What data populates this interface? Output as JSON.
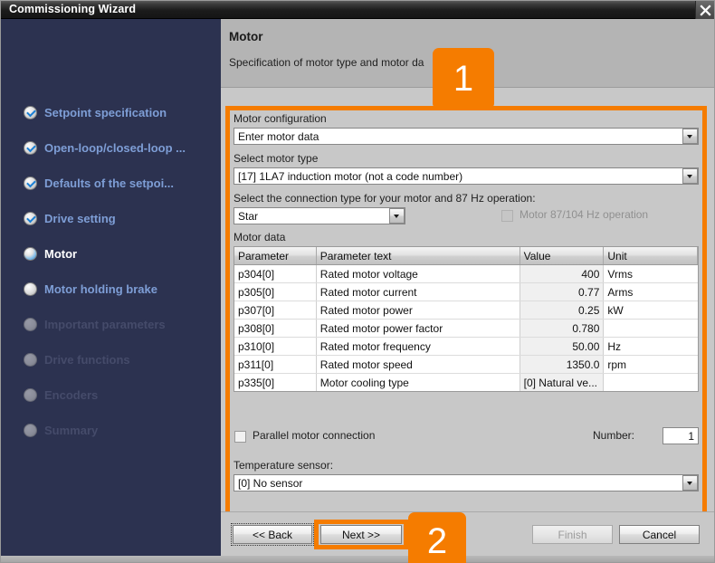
{
  "window": {
    "title": "Commissioning Wizard",
    "close_icon": "close-icon"
  },
  "sidebar": {
    "items": [
      {
        "label": "Setpoint specification",
        "state": "done"
      },
      {
        "label": "Open-loop/closed-loop ...",
        "state": "done"
      },
      {
        "label": "Defaults of the setpoi...",
        "state": "done"
      },
      {
        "label": "Drive setting",
        "state": "done"
      },
      {
        "label": "Motor",
        "state": "current"
      },
      {
        "label": "Motor holding brake",
        "state": "pending"
      },
      {
        "label": "Important parameters",
        "state": "disabled"
      },
      {
        "label": "Drive functions",
        "state": "disabled"
      },
      {
        "label": "Encoders",
        "state": "disabled"
      },
      {
        "label": "Summary",
        "state": "disabled"
      }
    ]
  },
  "header": {
    "title": "Motor",
    "subtitle": "Specification of motor type and motor da"
  },
  "form": {
    "motor_configuration_label": "Motor configuration",
    "motor_configuration_value": "Enter motor data",
    "select_motor_type_label": "Select motor type",
    "select_motor_type_value": "[17] 1LA7 induction motor (not a code number)",
    "connection_type_label": "Select the connection type for your motor and 87 Hz operation:",
    "connection_type_value": "Star",
    "hz_operation_checkbox_label": "Motor 87/104 Hz operation",
    "motor_data_label": "Motor data",
    "parallel_checkbox_label": "Parallel motor connection",
    "number_label": "Number:",
    "number_value": "1",
    "temperature_sensor_label": "Temperature sensor:",
    "temperature_sensor_value": "[0] No sensor"
  },
  "table": {
    "columns": [
      "Parameter",
      "Parameter text",
      "Value",
      "Unit"
    ],
    "rows": [
      {
        "parameter": "p304[0]",
        "text": "Rated motor voltage",
        "value": "400",
        "unit": "Vrms"
      },
      {
        "parameter": "p305[0]",
        "text": "Rated motor current",
        "value": "0.77",
        "unit": "Arms"
      },
      {
        "parameter": "p307[0]",
        "text": "Rated motor power",
        "value": "0.25",
        "unit": "kW"
      },
      {
        "parameter": "p308[0]",
        "text": "Rated motor power factor",
        "value": "0.780",
        "unit": ""
      },
      {
        "parameter": "p310[0]",
        "text": "Rated motor frequency",
        "value": "50.00",
        "unit": "Hz"
      },
      {
        "parameter": "p311[0]",
        "text": "Rated motor speed",
        "value": "1350.0",
        "unit": "rpm"
      },
      {
        "parameter": "p335[0]",
        "text": "Motor cooling type",
        "value": "[0] Natural ve...",
        "unit": ""
      }
    ]
  },
  "footer": {
    "back_label": "<< Back",
    "next_label": "Next >>",
    "finish_label": "Finish",
    "cancel_label": "Cancel"
  },
  "callouts": {
    "one": "1",
    "two": "2"
  },
  "colors": {
    "accent_orange": "#f57c00",
    "sidebar_bg": "#2c3250",
    "pane_bg": "#c8c8c8"
  }
}
